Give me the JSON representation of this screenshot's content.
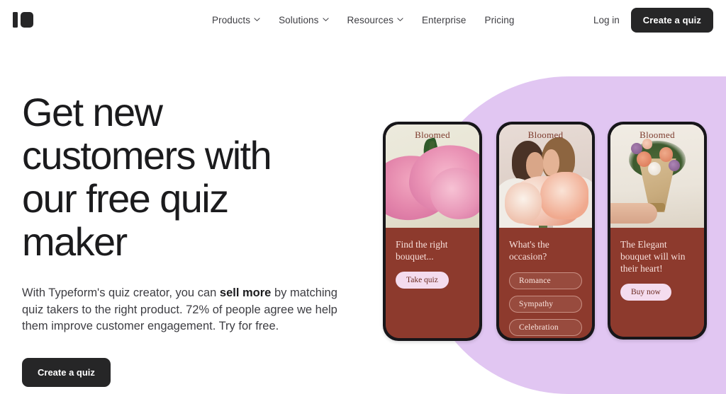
{
  "header": {
    "logo_name": "typeform-logo",
    "nav": [
      {
        "label": "Products",
        "has_dropdown": true
      },
      {
        "label": "Solutions",
        "has_dropdown": true
      },
      {
        "label": "Resources",
        "has_dropdown": true
      },
      {
        "label": "Enterprise",
        "has_dropdown": false
      },
      {
        "label": "Pricing",
        "has_dropdown": false
      }
    ],
    "login_label": "Log in",
    "cta_label": "Create a quiz"
  },
  "hero": {
    "headline": "Get new customers with our free quiz maker",
    "paragraph_part1": "With Typeform's quiz creator, you can ",
    "paragraph_bold": "sell more",
    "paragraph_part2": " by matching quiz takers to the right product. 72% of people agree we help them improve customer engagement. Try for free.",
    "cta_label": "Create a quiz"
  },
  "showcase": {
    "background_color": "#e1c6f2",
    "card_body_color": "#8d3a2d",
    "accent_pink": "#f4dcee",
    "cards": [
      {
        "brand": "Bloomed",
        "image_alt": "pink-peony-photo",
        "question": "Find the right bouquet...",
        "button_label": "Take quiz",
        "options": []
      },
      {
        "brand": "Bloomed",
        "image_alt": "couple-with-bouquet-photo",
        "question": "What's the occasion?",
        "button_label": "",
        "options": [
          "Romance",
          "Sympathy",
          "Celebration"
        ]
      },
      {
        "brand": "Bloomed",
        "image_alt": "wrapped-bouquet-photo",
        "question": "The Elegant bouquet will win their heart!",
        "button_label": "Buy now",
        "options": []
      }
    ]
  }
}
